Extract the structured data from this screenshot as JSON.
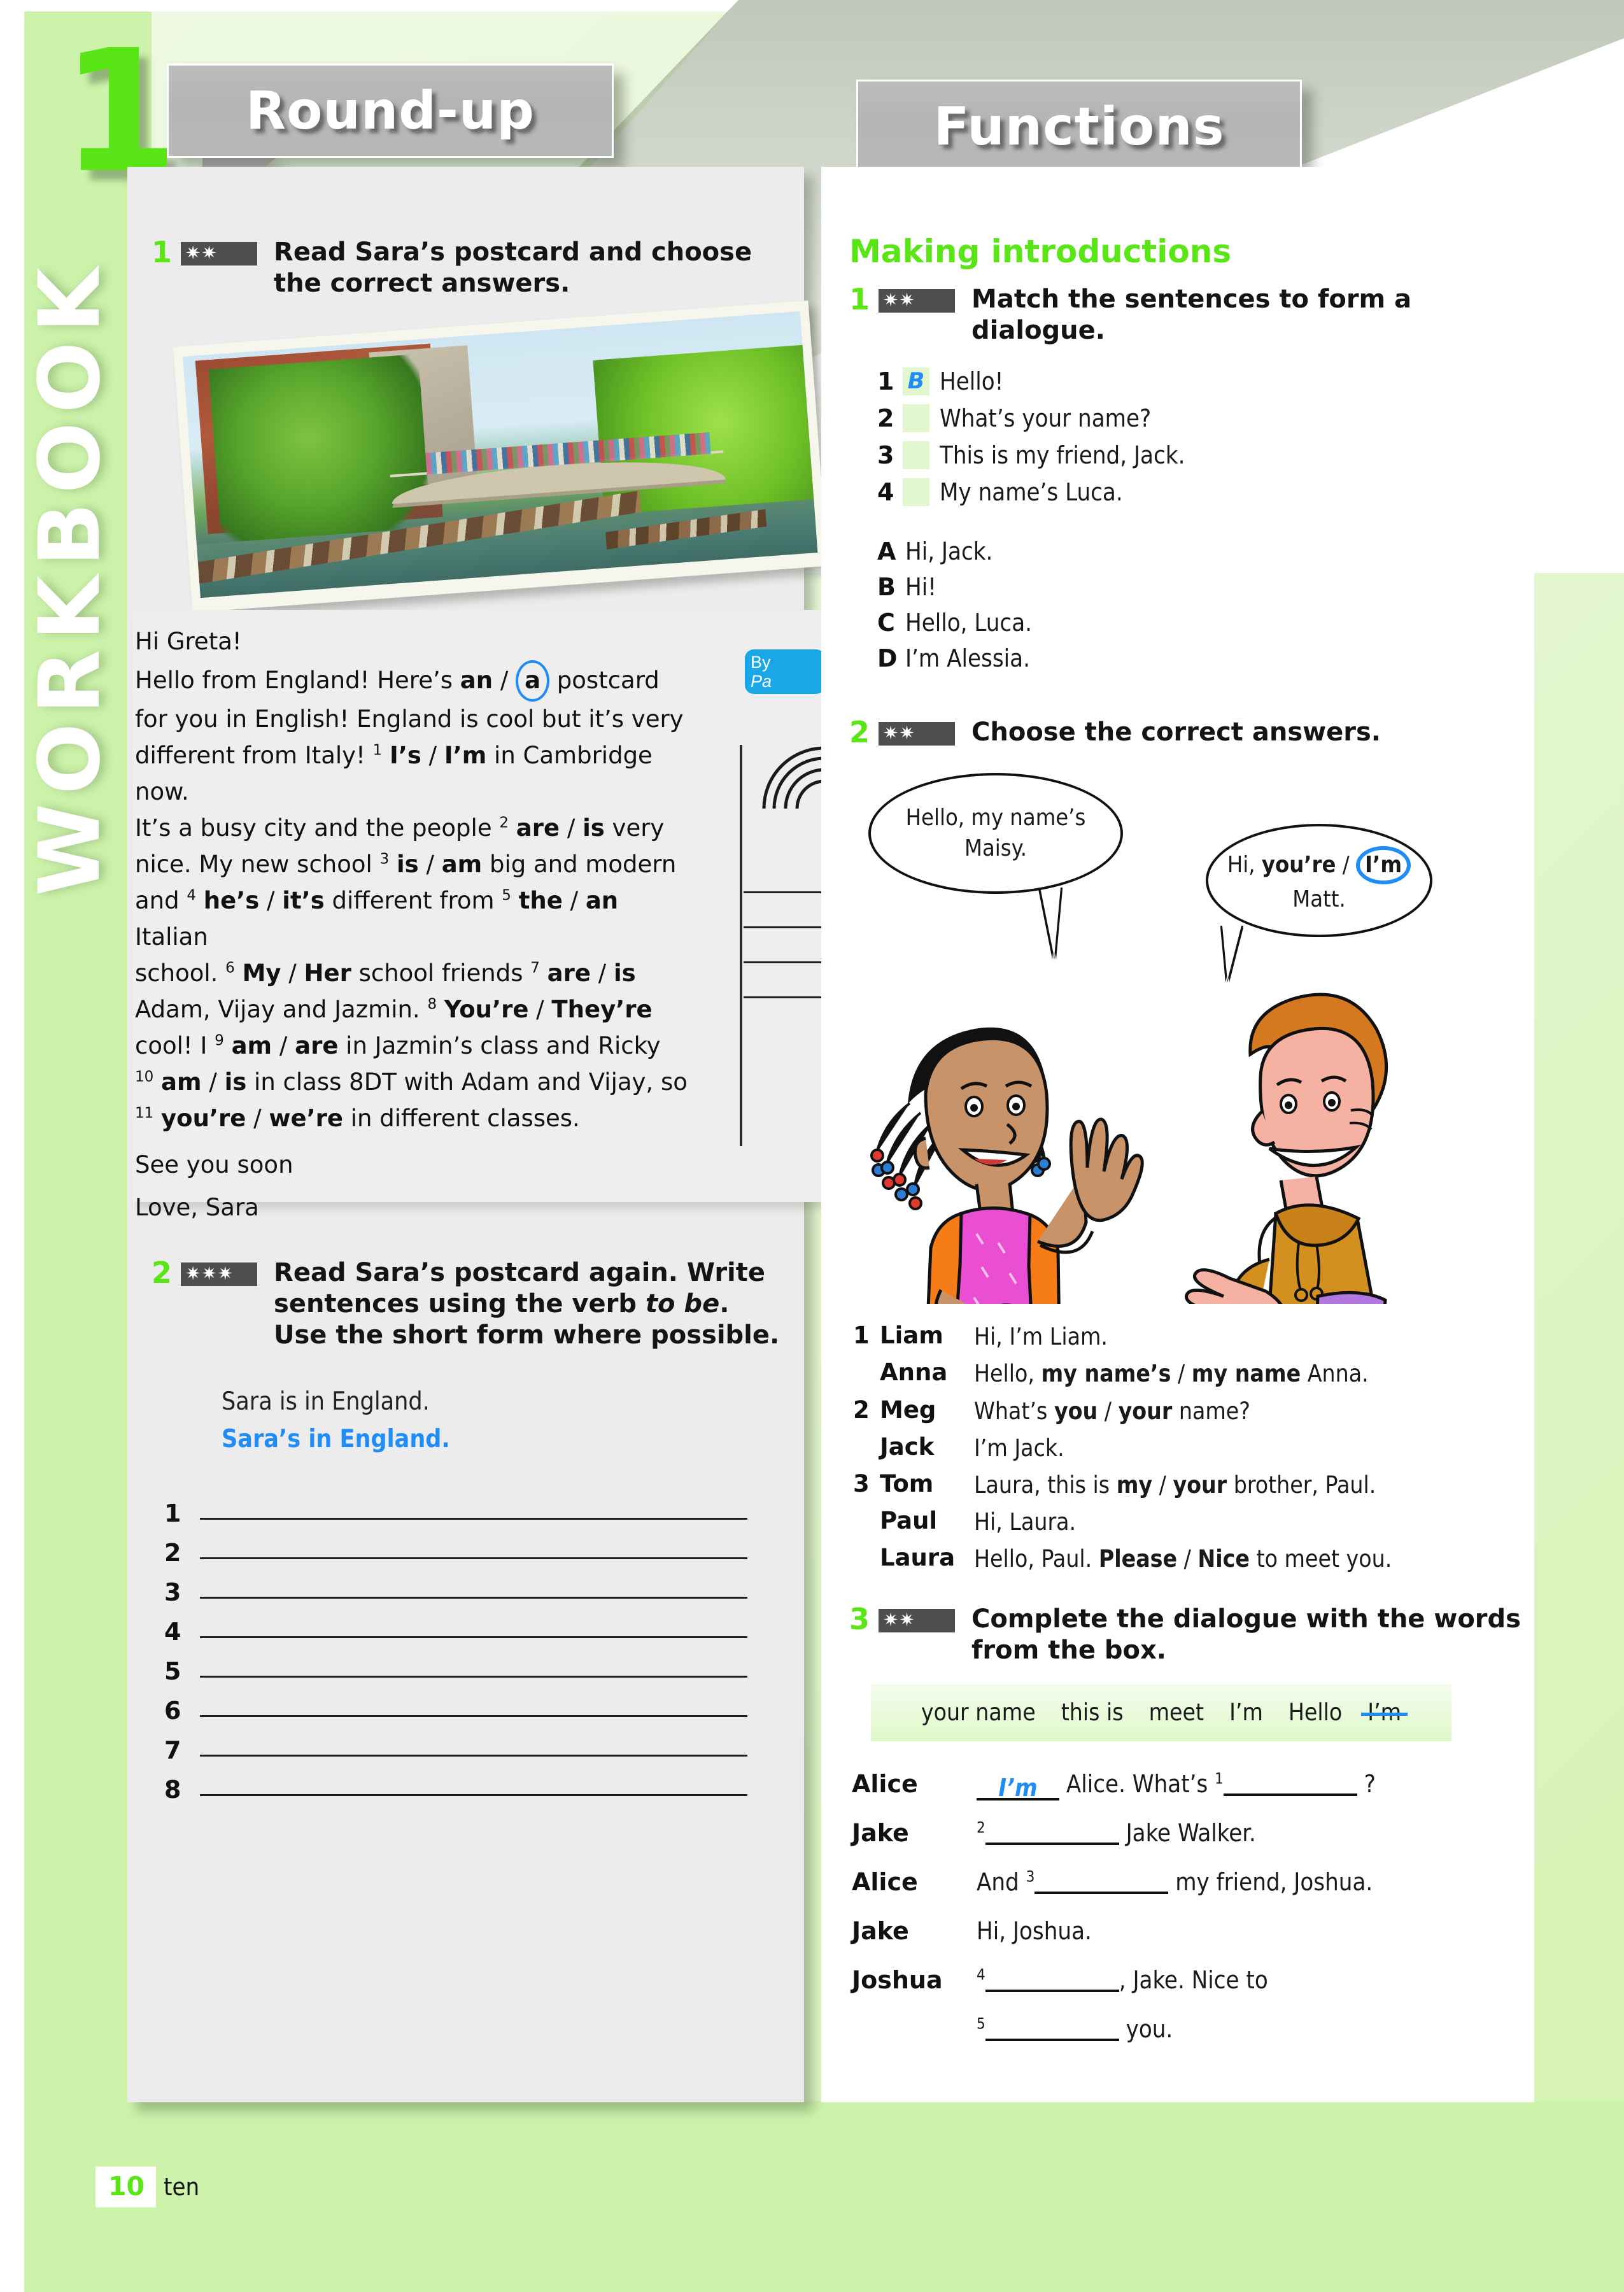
{
  "chapter": {
    "number": "1",
    "sidebar_label": "WORKBOOK"
  },
  "banners": {
    "left": "Round-up",
    "right": "Functions"
  },
  "left_column": {
    "exercise1": {
      "number": "1",
      "stars": "✷✷",
      "instruction": "Read Sara’s postcard and choose the correct answers."
    },
    "postcard": {
      "stamp_line1": "By",
      "stamp_line2": "Pa",
      "lines": [
        "Hi Greta!",
        "Hello from England! Here’s an / a postcard",
        "for you in English! England is cool but it’s very",
        "different from Italy! 1 I’s / I’m in Cambridge now.",
        "It’s a busy city and the people 2 are / is very",
        "nice. My new school 3 is / am big and modern",
        "and 4 he’s / it’s different from 5 the / an Italian",
        "school. 6 My / Her school friends 7 are / is",
        "Adam, Vijay and Jazmin. 8 You’re / They’re",
        "cool! I 9 am / are in Jazmin’s class and Ricky",
        "10 am / is in class 8DT with Adam and Vijay, so",
        "11 you’re / we’re in different classes.",
        "See you soon",
        "Love, Sara"
      ],
      "circled_answer": "a"
    },
    "exercise2": {
      "number": "2",
      "stars": "✷✷✷",
      "instruction_part1": "Read Sara’s postcard again. Write sentences using the verb ",
      "instruction_italic": "to be",
      "instruction_part2": ". Use the short form where possible.",
      "example_prompt": "Sara is in England.",
      "example_answer": "Sara’s in England.",
      "line_numbers": [
        "1",
        "2",
        "3",
        "4",
        "5",
        "6",
        "7",
        "8"
      ]
    }
  },
  "right_column": {
    "section_title": "Making introductions",
    "exercise1": {
      "number": "1",
      "stars": "✷✷",
      "instruction": "Match the sentences to form a dialogue.",
      "items": [
        {
          "num": "1",
          "answer": "B",
          "text": "Hello!"
        },
        {
          "num": "2",
          "answer": "",
          "text": "What’s your name?"
        },
        {
          "num": "3",
          "answer": "",
          "text": "This is my friend, Jack."
        },
        {
          "num": "4",
          "answer": "",
          "text": "My name’s Luca."
        }
      ],
      "options": [
        {
          "letter": "A",
          "text": "Hi, Jack."
        },
        {
          "letter": "B",
          "text": "Hi!"
        },
        {
          "letter": "C",
          "text": "Hello, Luca."
        },
        {
          "letter": "D",
          "text": "I’m Alessia."
        }
      ]
    },
    "exercise2": {
      "number": "2",
      "stars": "✷✷",
      "instruction": "Choose the correct answers.",
      "bubble_left": "Hello, my name’s Maisy.",
      "bubble_right_pre": "Hi, ",
      "bubble_right_opt1": "you’re",
      "bubble_right_sep": " / ",
      "bubble_right_opt2": "I’m",
      "bubble_right_post": " Matt.",
      "dialogues": [
        {
          "num": "1",
          "who": "Liam",
          "pre": "Hi, I’m Liam.",
          "opt1": "",
          "opt2": "",
          "post": ""
        },
        {
          "num": "",
          "who": "Anna",
          "pre": "Hello, ",
          "opt1": "my name’s",
          "opt2": "my name",
          "post": " Anna."
        },
        {
          "num": "2",
          "who": "Meg",
          "pre": "What’s ",
          "opt1": "you",
          "opt2": "your",
          "post": " name?"
        },
        {
          "num": "",
          "who": "Jack",
          "pre": "I’m Jack.",
          "opt1": "",
          "opt2": "",
          "post": ""
        },
        {
          "num": "3",
          "who": "Tom",
          "pre": "Laura, this is ",
          "opt1": "my",
          "opt2": "your",
          "post": " brother, Paul."
        },
        {
          "num": "",
          "who": "Paul",
          "pre": "Hi, Laura.",
          "opt1": "",
          "opt2": "",
          "post": ""
        },
        {
          "num": "",
          "who": "Laura",
          "pre": "Hello, Paul. ",
          "opt1": "Please",
          "opt2": "Nice",
          "post": " to meet you."
        }
      ]
    },
    "exercise3": {
      "number": "3",
      "stars": "✷✷",
      "instruction": "Complete the dialogue with the words from the box.",
      "word_box": [
        "your name",
        "this is",
        "meet",
        "I’m",
        "Hello",
        "I’m"
      ],
      "word_box_struck_index": 5,
      "lines": [
        {
          "who": "Alice",
          "filled": "I’m",
          "pre": "",
          "mid": " Alice. What’s ",
          "sup": "1",
          "post": " ?"
        },
        {
          "who": "Jake",
          "filled": "",
          "pre": "",
          "sup": "2",
          "mid": "",
          "post": " Jake Walker."
        },
        {
          "who": "Alice",
          "filled": "",
          "pre": "And ",
          "sup": "3",
          "mid": "",
          "post": " my friend, Joshua."
        },
        {
          "who": "Jake",
          "filled": "",
          "pre": "Hi, Joshua.",
          "sup": "",
          "mid": "",
          "post": ""
        },
        {
          "who": "Joshua",
          "filled": "",
          "pre": "",
          "sup": "4",
          "mid": "",
          "post": ", Jake. Nice to"
        },
        {
          "who": "",
          "filled": "",
          "pre": "",
          "sup": "5",
          "mid": "",
          "post": " you."
        }
      ]
    }
  },
  "footer": {
    "page_number": "10",
    "page_word": "ten"
  },
  "colors": {
    "accent_green": "#5ae616",
    "board_green": "#cdf3ab",
    "answer_blue": "#1f8df5",
    "banner_grey": "#b7b7b7",
    "column_grey": "#ececec",
    "stars_bg": "#4e4e4e",
    "match_box": "#e2f7cd"
  }
}
